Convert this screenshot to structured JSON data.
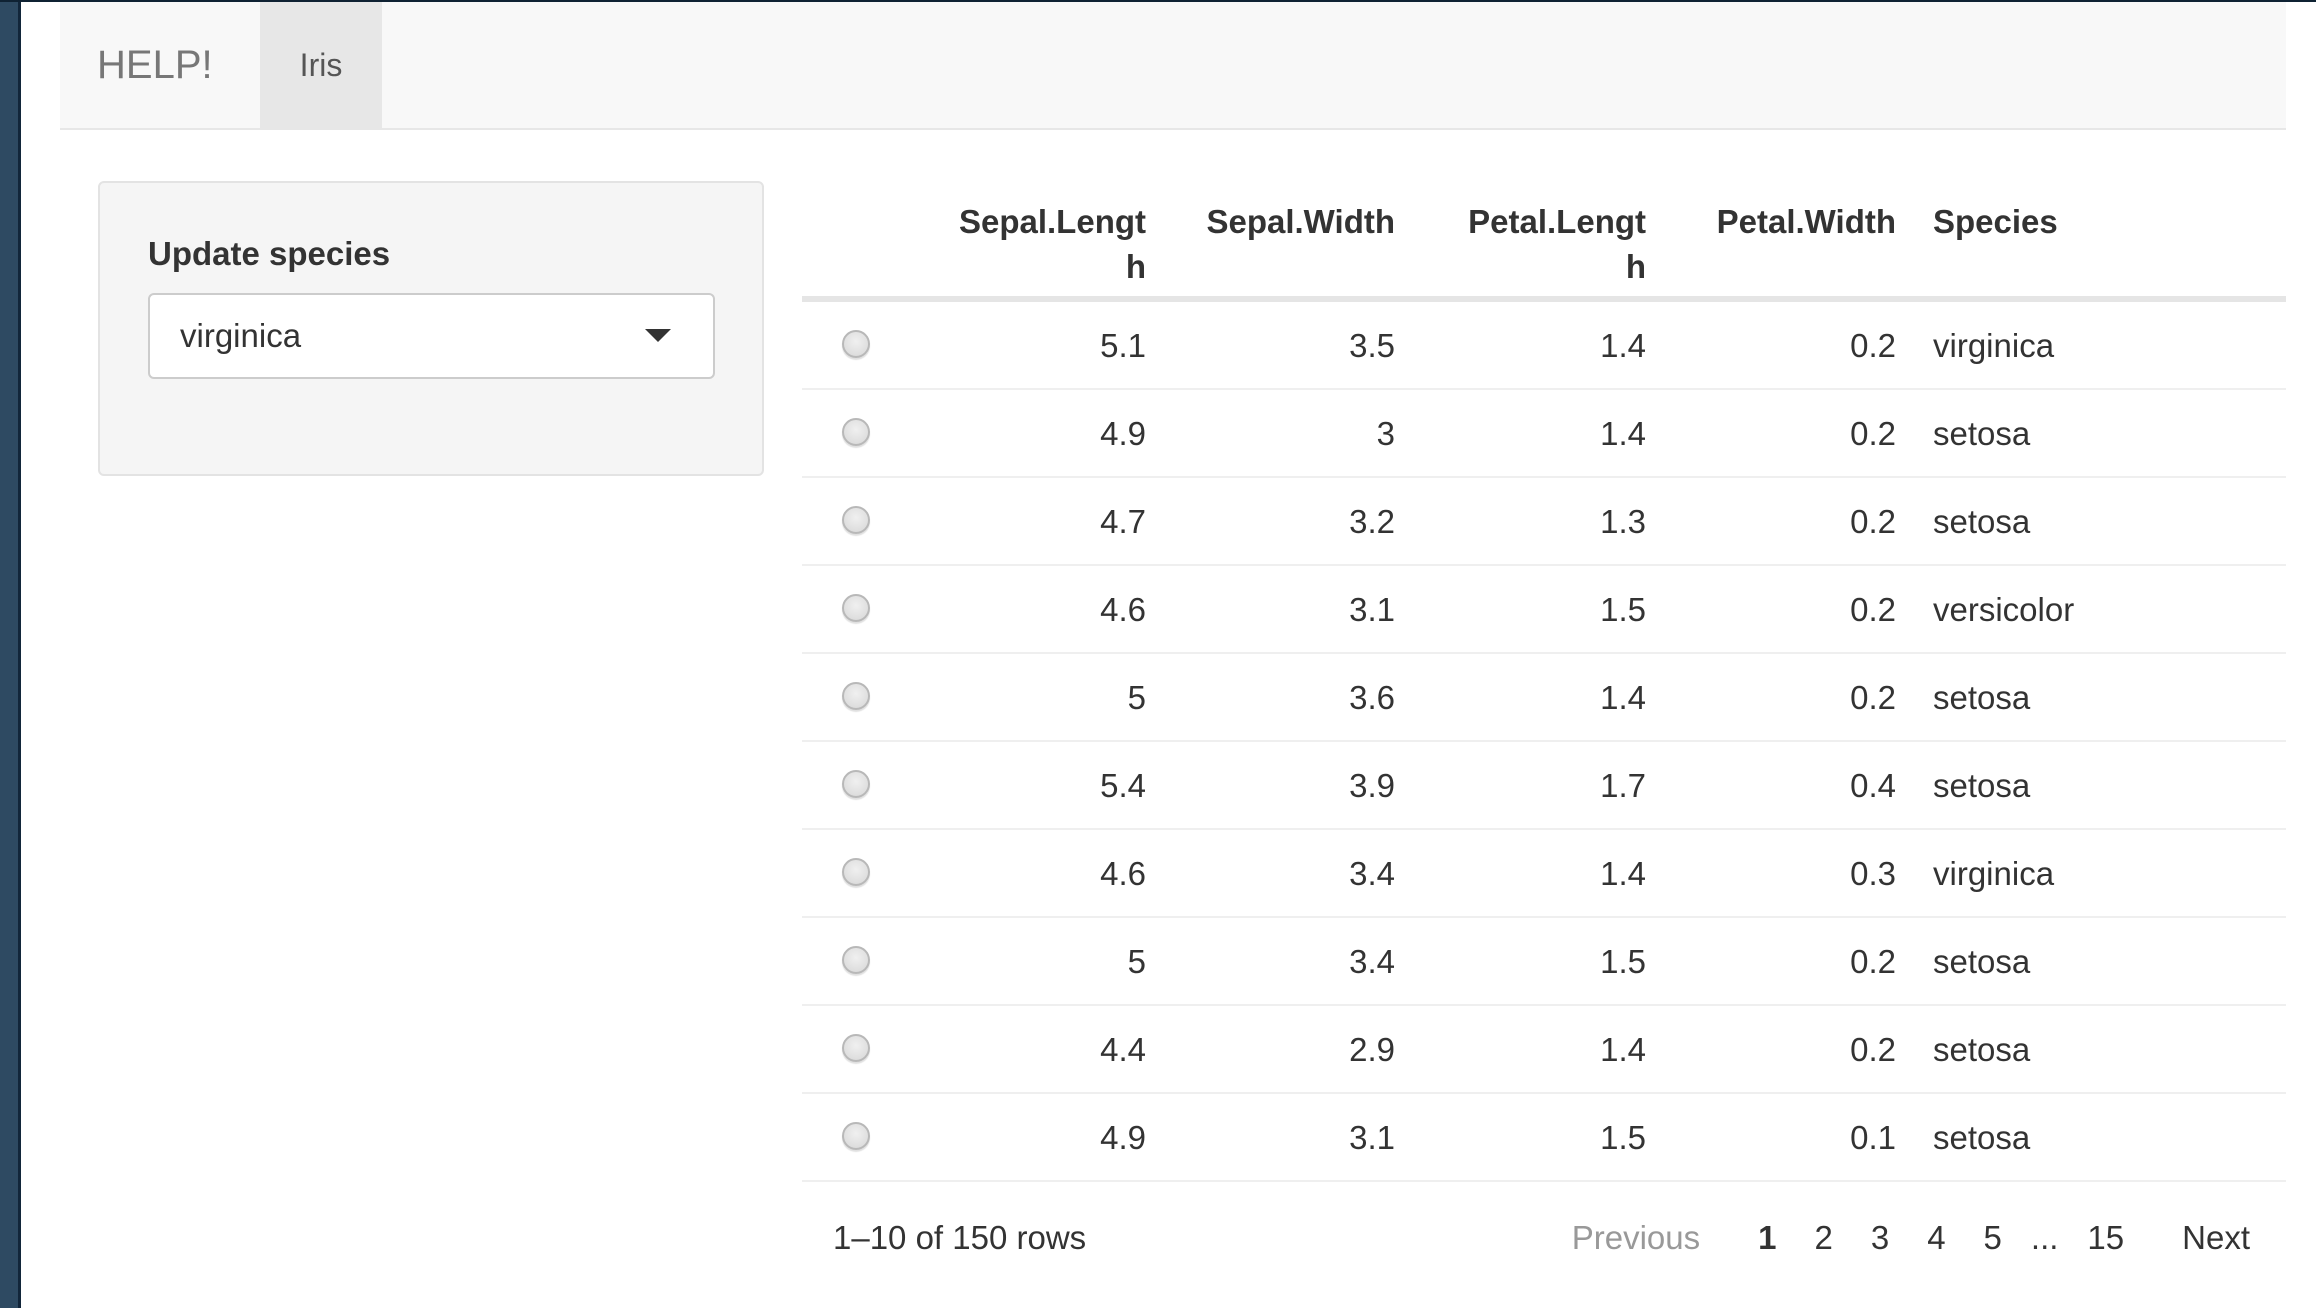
{
  "navbar": {
    "brand": "HELP!",
    "tabs": [
      {
        "label": "Iris",
        "active": true
      }
    ]
  },
  "sidebar": {
    "label": "Update species",
    "select": {
      "value": "virginica"
    }
  },
  "table": {
    "columns": [
      "",
      "Sepal.Length",
      "Sepal.Width",
      "Petal.Length",
      "Petal.Width",
      "Species"
    ],
    "header_display": {
      "sepal_length": [
        "Sepal.Lengt",
        "h"
      ],
      "sepal_width": "Sepal.Width",
      "petal_length": [
        "Petal.Lengt",
        "h"
      ],
      "petal_width": "Petal.Width",
      "species": "Species"
    },
    "rows": [
      [
        "5.1",
        "3.5",
        "1.4",
        "0.2",
        "virginica"
      ],
      [
        "4.9",
        "3",
        "1.4",
        "0.2",
        "setosa"
      ],
      [
        "4.7",
        "3.2",
        "1.3",
        "0.2",
        "setosa"
      ],
      [
        "4.6",
        "3.1",
        "1.5",
        "0.2",
        "versicolor"
      ],
      [
        "5",
        "3.6",
        "1.4",
        "0.2",
        "setosa"
      ],
      [
        "5.4",
        "3.9",
        "1.7",
        "0.4",
        "setosa"
      ],
      [
        "4.6",
        "3.4",
        "1.4",
        "0.3",
        "virginica"
      ],
      [
        "5",
        "3.4",
        "1.5",
        "0.2",
        "setosa"
      ],
      [
        "4.4",
        "2.9",
        "1.4",
        "0.2",
        "setosa"
      ],
      [
        "4.9",
        "3.1",
        "1.5",
        "0.1",
        "setosa"
      ]
    ]
  },
  "footer": {
    "info": "1–10 of 150 rows",
    "pagination": {
      "previous": "Previous",
      "pages": [
        "1",
        "2",
        "3",
        "4",
        "5"
      ],
      "ellipsis": "...",
      "last": "15",
      "next": "Next",
      "current": "1"
    }
  },
  "colors": {
    "navbar_bg": "#f8f8f8",
    "active_tab_bg": "#e7e7e7",
    "well_bg": "#f5f5f5",
    "text": "#333333",
    "muted": "#999999",
    "window_edge": "#2e4a62"
  }
}
